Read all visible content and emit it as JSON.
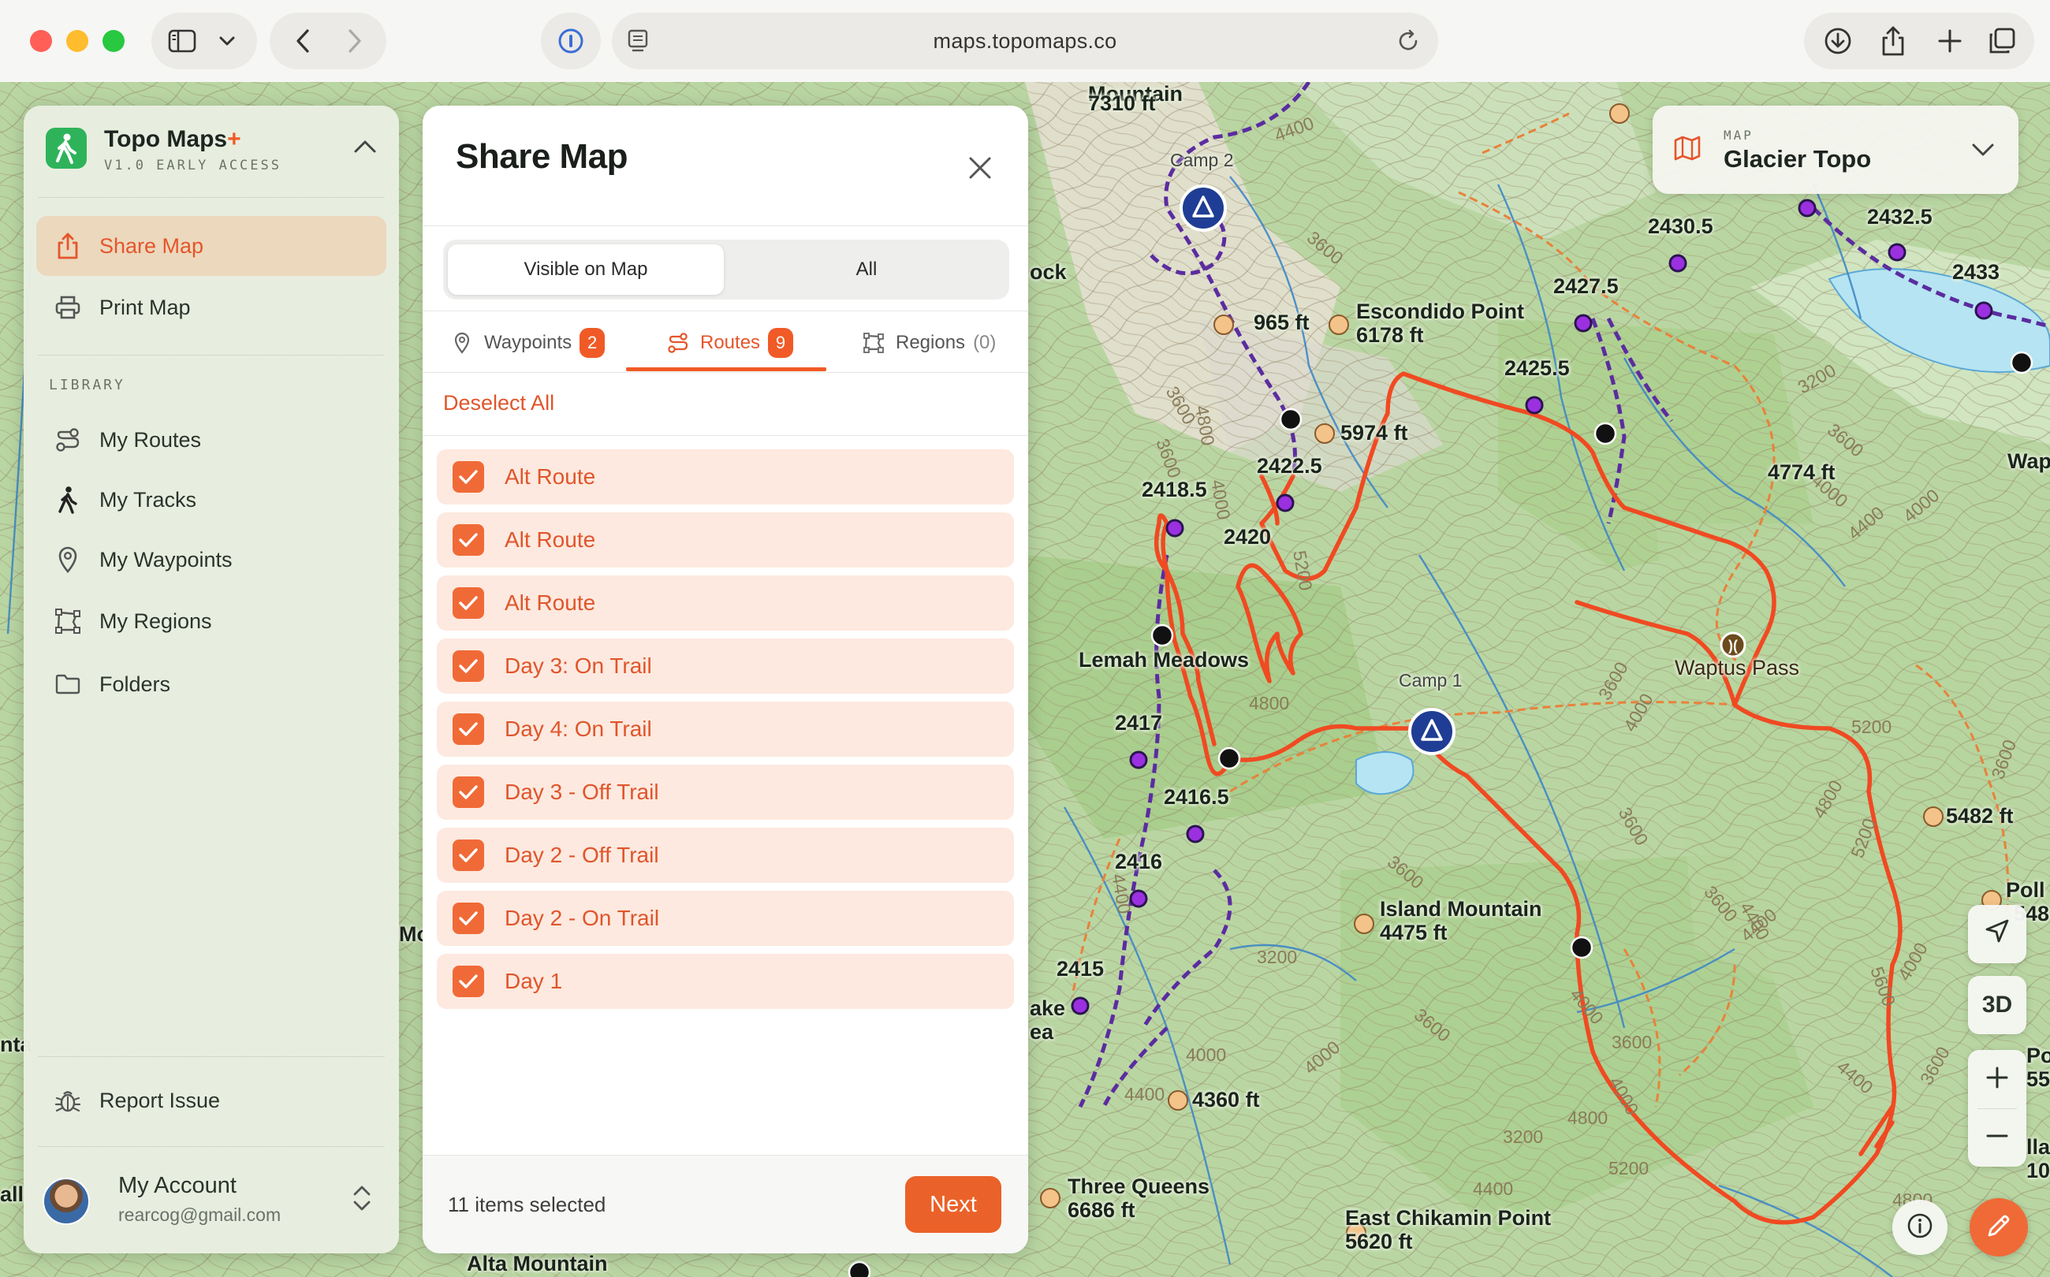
{
  "browser": {
    "url": "maps.topomaps.co",
    "icons": [
      "sidebar-toggle-icon",
      "chevron-down-icon",
      "back-icon",
      "forward-icon",
      "password-icon",
      "reader-icon",
      "reload-icon",
      "download-icon",
      "share-icon",
      "new-tab-icon",
      "tabs-overview-icon"
    ]
  },
  "sidebar": {
    "app_name": "Topo Maps",
    "app_plus": "+",
    "app_version": "V1.0 EARLY ACCESS",
    "top_items": [
      {
        "label": "Share Map",
        "icon": "share-icon",
        "active": true
      },
      {
        "label": "Print Map",
        "icon": "printer-icon",
        "active": false
      }
    ],
    "library_heading": "LIBRARY",
    "library_items": [
      {
        "label": "My Routes",
        "icon": "route-icon"
      },
      {
        "label": "My Tracks",
        "icon": "hiker-icon"
      },
      {
        "label": "My Waypoints",
        "icon": "pin-icon"
      },
      {
        "label": "My Regions",
        "icon": "region-icon"
      },
      {
        "label": "Folders",
        "icon": "folder-icon"
      }
    ],
    "report_issue": "Report Issue",
    "account": {
      "name": "My Account",
      "email": "rearcog@gmail.com"
    }
  },
  "share_panel": {
    "title": "Share Map",
    "segments": {
      "visible": "Visible on Map",
      "all": "All"
    },
    "tabs": {
      "waypoints": {
        "label": "Waypoints",
        "count": "2"
      },
      "routes": {
        "label": "Routes",
        "count": "9"
      },
      "regions": {
        "label": "Regions",
        "count": "(0)"
      }
    },
    "deselect_all": "Deselect All",
    "routes": [
      {
        "label": "Alt Route",
        "checked": true
      },
      {
        "label": "Alt Route",
        "checked": true
      },
      {
        "label": "Alt Route",
        "checked": true
      },
      {
        "label": "Day 3: On Trail",
        "checked": true
      },
      {
        "label": "Day 4: On Trail",
        "checked": true
      },
      {
        "label": "Day 3 - Off Trail",
        "checked": true
      },
      {
        "label": "Day 2 - Off Trail",
        "checked": true
      },
      {
        "label": "Day 2 - On Trail",
        "checked": true
      },
      {
        "label": "Day 1",
        "checked": true
      }
    ],
    "selected_count": "11 items selected",
    "next_label": "Next"
  },
  "map": {
    "selector_label": "MAP",
    "selector_value": "Glacier Topo",
    "three_d": "3D",
    "labels": {
      "mountain_7310": "7310 ft",
      "mountain_name": "Mountain",
      "camp2": "Camp 2",
      "ft_965": "965 ft",
      "escondido_name": "Escondido Point",
      "escondido_elev": "6178 ft",
      "w2430_5": "2430.5",
      "w2432_5": "2432.5",
      "w2433": "2433",
      "w2427_5": "2427.5",
      "w2425_5": "2425.5",
      "ft_5974": "5974 ft",
      "w2422_5": "2422.5",
      "w2418_5": "2418.5",
      "w2420": "2420",
      "ft_4774": "4774 ft",
      "wap": "Wap",
      "lemah": "Lemah Meadows",
      "camp1": "Camp 1",
      "waptus_pass": "Waptus Pass",
      "w2417": "2417",
      "w2416_5": "2416.5",
      "w2416": "2416",
      "w2415": "2415",
      "ft_5482": "5482 ft",
      "island_name": "Island Mountain",
      "island_elev": "4475 ft",
      "ft_4360": "4360 ft",
      "three_queens_name": "Three Queens",
      "three_queens_elev": "6686 ft",
      "east_chikamin_name": "East Chikamin Point",
      "east_chikamin_elev": "5620 ft",
      "alta_mountain": "Alta Mountain",
      "ock": "ock",
      "ake": "ake",
      "ea": "ea",
      "poll": "Poll",
      "p548": "548",
      "po": "Po",
      "p55": "55",
      "lla": "lla",
      "p10": "10",
      "all": "all",
      "nta": "nta",
      "mo": "Mo"
    },
    "contours": [
      "4800",
      "3600",
      "4400",
      "3600",
      "4800",
      "4000",
      "3600",
      "4800",
      "5200",
      "5200",
      "4400",
      "3200",
      "3600",
      "4000",
      "4400",
      "4000",
      "3600",
      "3600",
      "4800",
      "5200",
      "4400",
      "4400",
      "4000",
      "3600",
      "3200",
      "3600",
      "4000",
      "4400",
      "4800",
      "4400",
      "3600",
      "5200",
      "4000",
      "3600",
      "4400",
      "3600",
      "4000",
      "3200",
      "4000",
      "3600",
      "4800",
      "5600",
      "4000"
    ],
    "colors": {
      "route": "#f04a22",
      "track": "#5b2ca0",
      "waypoint": "#9b30e0",
      "camp": "#1f3d94",
      "accent": "#f05a26"
    }
  }
}
